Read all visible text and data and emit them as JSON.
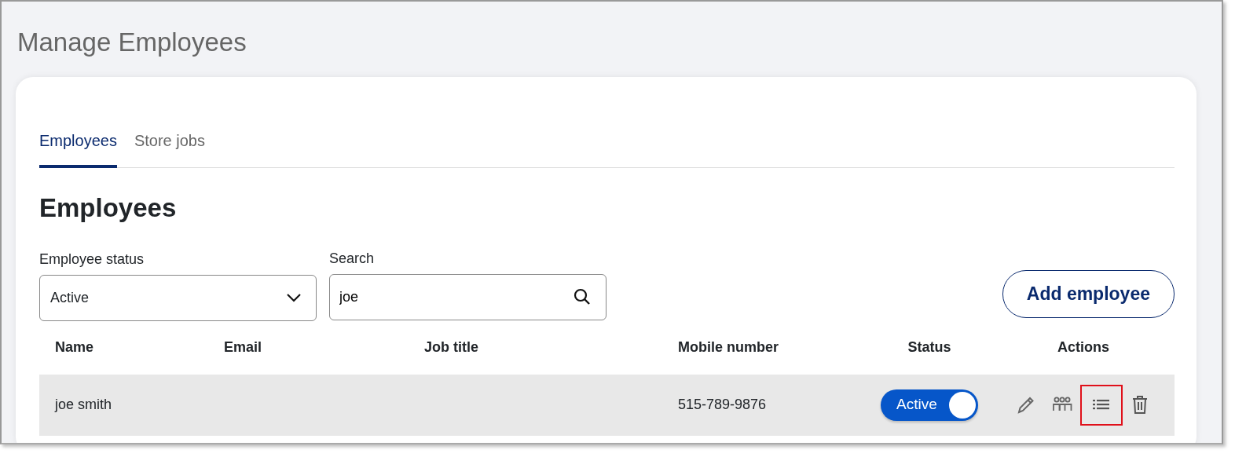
{
  "page_title": "Manage Employees",
  "tabs": [
    {
      "label": "Employees",
      "selected": true
    },
    {
      "label": "Store jobs",
      "selected": false
    }
  ],
  "section_title": "Employees",
  "filters": {
    "status": {
      "label": "Employee status",
      "value": "Active"
    },
    "search": {
      "label": "Search",
      "value": "joe"
    }
  },
  "add_button": "Add employee",
  "table": {
    "columns": [
      "Name",
      "Email",
      "Job title",
      "Mobile number",
      "Status",
      "Actions"
    ],
    "rows": [
      {
        "name": "joe smith",
        "mobile": "515-789-9876",
        "status": {
          "label": "Active",
          "on": true
        },
        "actions": [
          {
            "kind": "edit",
            "highlighted": false
          },
          {
            "kind": "team",
            "highlighted": false
          },
          {
            "kind": "list",
            "highlighted": true
          },
          {
            "kind": "delete",
            "highlighted": false
          }
        ]
      }
    ]
  }
}
